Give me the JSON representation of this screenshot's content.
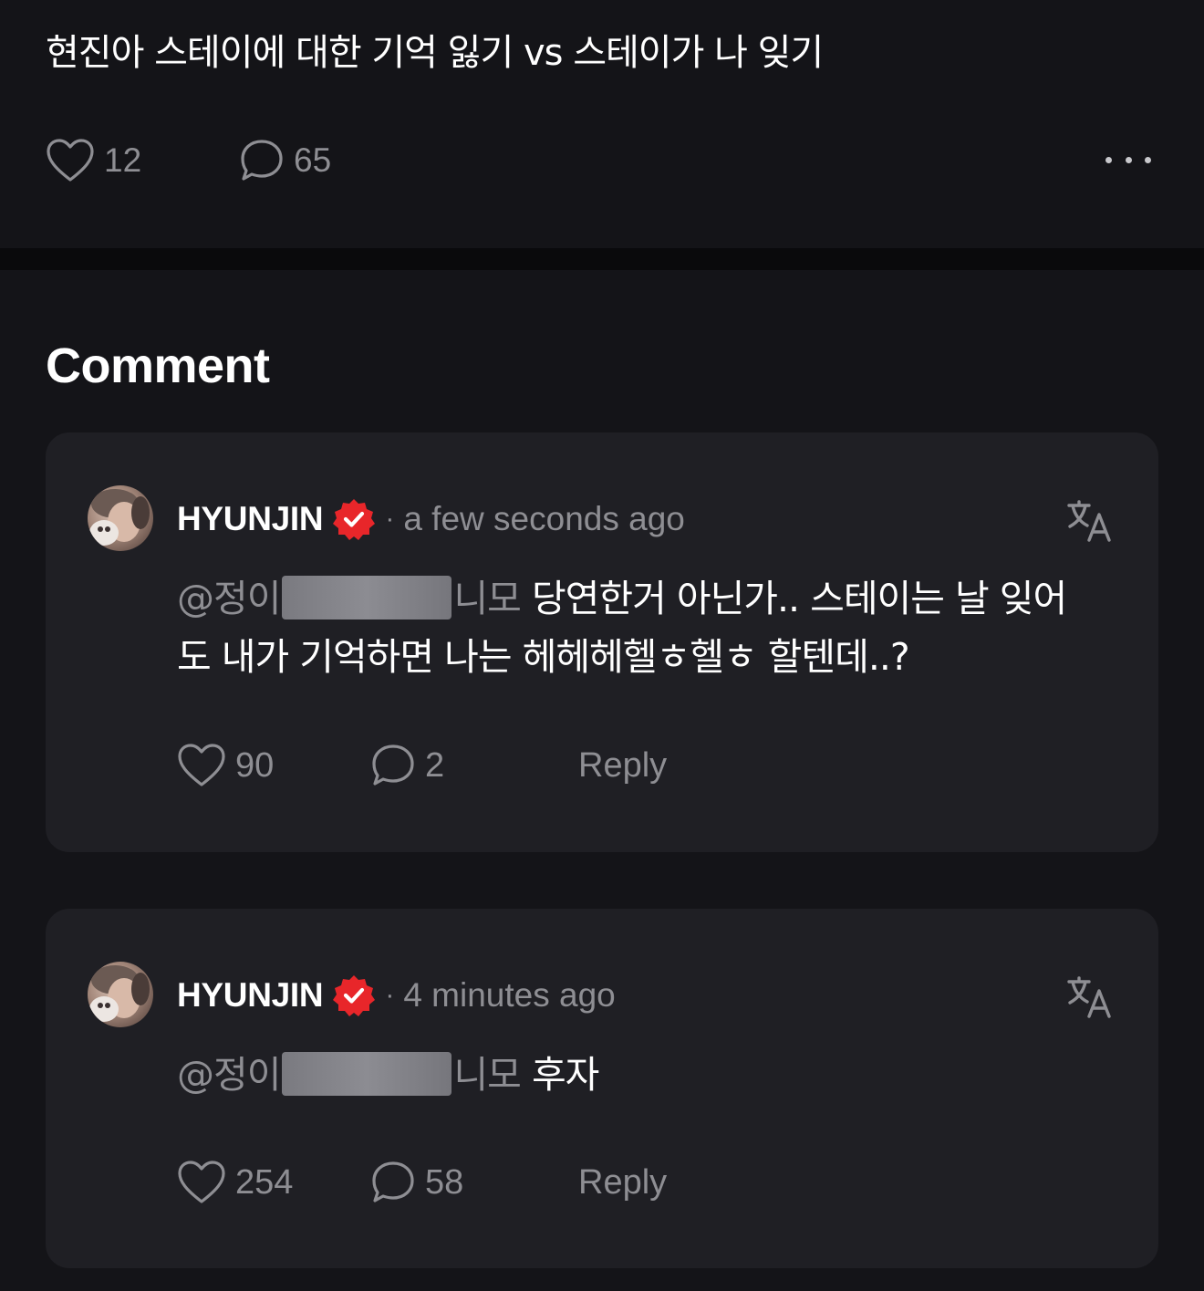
{
  "post": {
    "title": "현진아 스테이에 대한 기억 잃기 vs 스테이가 나 잊기",
    "likes": "12",
    "comments": "65"
  },
  "comments_section": {
    "heading": "Comment"
  },
  "comments": [
    {
      "author": "HYUNJIN",
      "separator": "·",
      "time": "a few seconds ago",
      "mention_prefix": "@정이",
      "mention_suffix": "니모",
      "text": " 당연한거 아닌가.. 스테이는 날 잊어도 내가 기억하면 나는 헤헤헤헬ㅎ헬ㅎ 할텐데..?",
      "likes": "90",
      "replies": "2",
      "reply_label": "Reply"
    },
    {
      "author": "HYUNJIN",
      "separator": "·",
      "time": "4 minutes ago",
      "mention_prefix": "@정이",
      "mention_suffix": "니모",
      "text": " 후자",
      "likes": "254",
      "replies": "58",
      "reply_label": "Reply"
    }
  ],
  "icons": {
    "like": "heart-icon",
    "comment": "speech-bubble-icon",
    "more": "more-horizontal-icon",
    "verified": "verified-badge-icon",
    "translate": "translate-icon"
  },
  "colors": {
    "background": "#141418",
    "card": "#1f1f24",
    "muted_text": "#8e8e93",
    "verified_badge": "#e8262a"
  }
}
